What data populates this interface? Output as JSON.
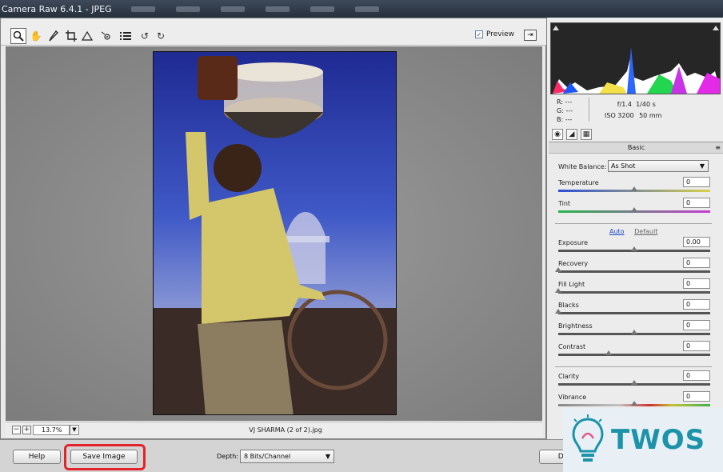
{
  "window": {
    "title": "Camera Raw 6.4.1  -  JPEG"
  },
  "toolbar": {
    "tools": [
      "zoom-tool-icon",
      "hand-tool-icon",
      "white-balance-tool-icon",
      "crop-tool-icon",
      "straighten-tool-icon",
      "red-eye-tool-icon",
      "preferences-icon",
      "rotate-left-icon",
      "rotate-right-icon"
    ],
    "preview_label": "Preview",
    "preview_checked": true
  },
  "status": {
    "zoom": "13.7%",
    "filename": "VJ SHARMA (2 of 2).jpg"
  },
  "readout": {
    "r": "R:   ---",
    "g": "G:   ---",
    "b": "B:   ---"
  },
  "camera": {
    "aperture": "f/1.4",
    "shutter": "1/40 s",
    "iso": "ISO 3200",
    "focal": "50 mm"
  },
  "panel": {
    "title": "Basic",
    "white_balance_label": "White Balance:",
    "white_balance_value": "As Shot",
    "auto_label": "Auto",
    "default_label": "Default",
    "controls": [
      {
        "label": "Temperature",
        "value": "0",
        "pos": 0.5
      },
      {
        "label": "Tint",
        "value": "0",
        "pos": 0.5
      },
      {
        "label": "Exposure",
        "value": "0.00",
        "pos": 0.5
      },
      {
        "label": "Recovery",
        "value": "0",
        "pos": 0.0
      },
      {
        "label": "Fill Light",
        "value": "0",
        "pos": 0.0
      },
      {
        "label": "Blacks",
        "value": "0",
        "pos": 0.0
      },
      {
        "label": "Brightness",
        "value": "0",
        "pos": 0.5
      },
      {
        "label": "Contrast",
        "value": "0",
        "pos": 0.33
      },
      {
        "label": "Clarity",
        "value": "0",
        "pos": 0.5
      },
      {
        "label": "Vibrance",
        "value": "0",
        "pos": 0.5
      }
    ]
  },
  "bottom": {
    "help_label": "Help",
    "save_label": "Save Image",
    "depth_label": "Depth:",
    "depth_value": "8 Bits/Channel",
    "done_label": "Do"
  },
  "watermark": {
    "text": "TWOS"
  },
  "colors": {
    "highlight": "#e3232b",
    "link": "#1f47c8",
    "watermark": "#1c93a9"
  }
}
